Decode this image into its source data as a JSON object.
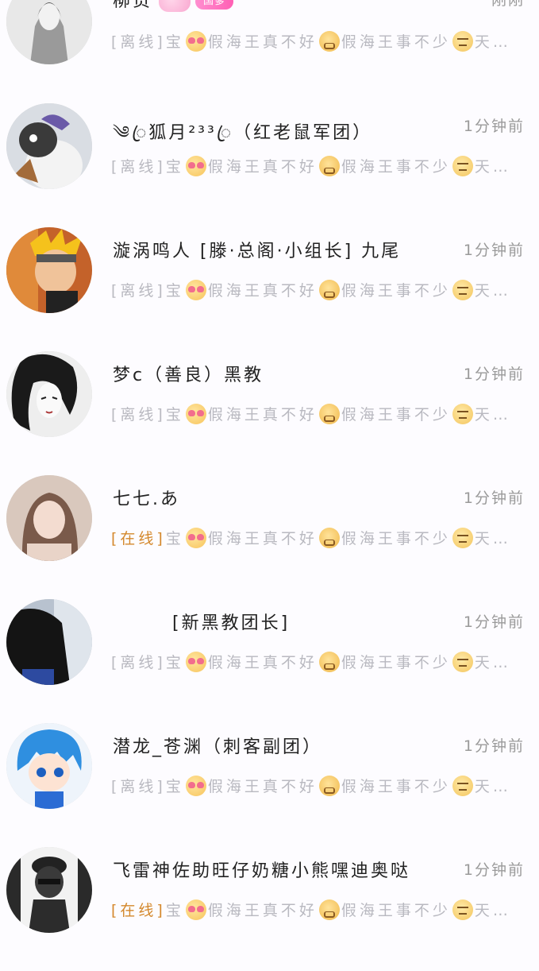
{
  "contacts": [
    {
      "name": "柳贡",
      "badge": "国爹",
      "time": "刚刚",
      "status": "[离线]",
      "status_type": "offline",
      "avatar_icon": "girl-sketch-avatar",
      "preview": [
        "宝",
        "love-emoji",
        "假海王真不好",
        "angry-emoji",
        "假海王事不少",
        "meh-emoji",
        "天…"
      ]
    },
    {
      "name": "༄ꦿ狐月²³³ꦿ（红老鼠军团）",
      "time": "1分钟前",
      "status": "[离线]",
      "status_type": "offline",
      "avatar_icon": "penguin-avatar",
      "preview": [
        "宝",
        "love-emoji",
        "假海王真不好",
        "angry-emoji",
        "假海王事不少",
        "meh-emoji",
        "天…"
      ]
    },
    {
      "name": "漩涡鸣人 [滕·总阁·小组长] 九尾",
      "time": "1分钟前",
      "status": "[离线]",
      "status_type": "offline",
      "avatar_icon": "ninja-avatar",
      "preview": [
        "宝",
        "love-emoji",
        "假海王真不好",
        "angry-emoji",
        "假海王事不少",
        "meh-emoji",
        "天…"
      ]
    },
    {
      "name": "梦c（善良）黑教",
      "time": "1分钟前",
      "status": "[离线]",
      "status_type": "offline",
      "avatar_icon": "ink-girl-avatar",
      "preview": [
        "宝",
        "love-emoji",
        "假海王真不好",
        "angry-emoji",
        "假海王事不少",
        "meh-emoji",
        "天…"
      ]
    },
    {
      "name": "七七.あ",
      "time": "1分钟前",
      "status": "[在线]",
      "status_type": "online",
      "avatar_icon": "woman-photo-avatar",
      "preview": [
        "宝",
        "love-emoji",
        "假海王真不好",
        "angry-emoji",
        "假海王事不少",
        "meh-emoji",
        "天…"
      ]
    },
    {
      "name": "　　　[新黑教团长]",
      "time": "1分钟前",
      "status": "[离线]",
      "status_type": "offline",
      "avatar_icon": "dark-figure-avatar",
      "preview": [
        "宝",
        "love-emoji",
        "假海王真不好",
        "angry-emoji",
        "假海王事不少",
        "meh-emoji",
        "天…"
      ]
    },
    {
      "name": "潜龙_苍渊（刺客副团）",
      "time": "1分钟前",
      "status": "[离线]",
      "status_type": "offline",
      "avatar_icon": "blue-hair-anime-avatar",
      "preview": [
        "宝",
        "love-emoji",
        "假海王真不好",
        "angry-emoji",
        "假海王事不少",
        "meh-emoji",
        "天…"
      ]
    },
    {
      "name": "飞雷神佐助旺仔奶糖小熊嘿迪奥哒",
      "time": "1分钟前",
      "status": "[在线]",
      "status_type": "online",
      "avatar_icon": "cartoon-man-avatar",
      "preview": [
        "宝",
        "love-emoji",
        "假海王真不好",
        "angry-emoji",
        "假海王事不少",
        "meh-emoji",
        "天…"
      ]
    }
  ]
}
